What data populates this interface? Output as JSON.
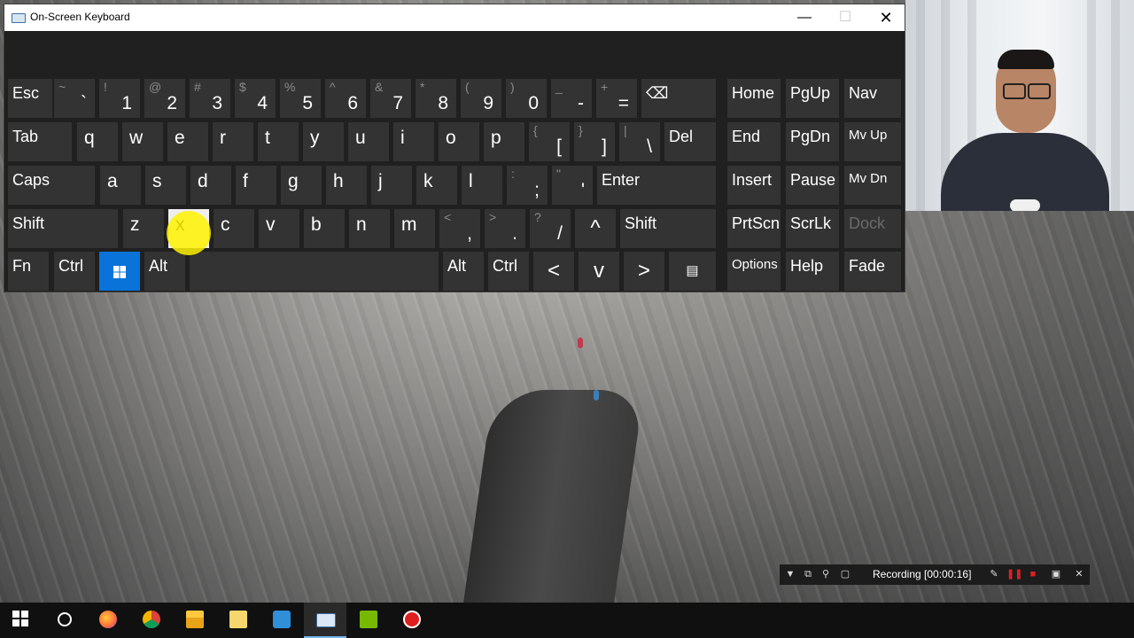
{
  "window": {
    "title": "On-Screen Keyboard"
  },
  "keyboard": {
    "rows": [
      [
        {
          "id": "esc",
          "label": "Esc"
        },
        {
          "id": "backtick",
          "shift": "~",
          "sub": "`"
        },
        {
          "id": "1",
          "shift": "!",
          "sub": "1"
        },
        {
          "id": "2",
          "shift": "@",
          "sub": "2"
        },
        {
          "id": "3",
          "shift": "#",
          "sub": "3"
        },
        {
          "id": "4",
          "shift": "$",
          "sub": "4"
        },
        {
          "id": "5",
          "shift": "%",
          "sub": "5"
        },
        {
          "id": "6",
          "shift": "^",
          "sub": "6"
        },
        {
          "id": "7",
          "shift": "&",
          "sub": "7"
        },
        {
          "id": "8",
          "shift": "*",
          "sub": "8"
        },
        {
          "id": "9",
          "shift": "(",
          "sub": "9"
        },
        {
          "id": "0",
          "shift": ")",
          "sub": "0"
        },
        {
          "id": "minus",
          "shift": "_",
          "sub": "-"
        },
        {
          "id": "equals",
          "shift": "+",
          "sub": "="
        },
        {
          "id": "backspace",
          "label": "⌫"
        }
      ],
      [
        {
          "id": "tab",
          "label": "Tab"
        },
        {
          "id": "q",
          "sub": "q"
        },
        {
          "id": "w",
          "sub": "w"
        },
        {
          "id": "e",
          "sub": "e"
        },
        {
          "id": "r",
          "sub": "r"
        },
        {
          "id": "t",
          "sub": "t"
        },
        {
          "id": "y",
          "sub": "y"
        },
        {
          "id": "u",
          "sub": "u"
        },
        {
          "id": "i",
          "sub": "i"
        },
        {
          "id": "o",
          "sub": "o"
        },
        {
          "id": "p",
          "sub": "p"
        },
        {
          "id": "lbracket",
          "shift": "{",
          "sub": "["
        },
        {
          "id": "rbracket",
          "shift": "}",
          "sub": "]"
        },
        {
          "id": "backslash",
          "shift": "|",
          "sub": "\\"
        },
        {
          "id": "del",
          "label": "Del"
        }
      ],
      [
        {
          "id": "caps",
          "label": "Caps"
        },
        {
          "id": "a",
          "sub": "a"
        },
        {
          "id": "s",
          "sub": "s"
        },
        {
          "id": "d",
          "sub": "d"
        },
        {
          "id": "f",
          "sub": "f"
        },
        {
          "id": "g",
          "sub": "g"
        },
        {
          "id": "h",
          "sub": "h"
        },
        {
          "id": "j",
          "sub": "j"
        },
        {
          "id": "k",
          "sub": "k"
        },
        {
          "id": "l",
          "sub": "l"
        },
        {
          "id": "semicolon",
          "shift": ":",
          "sub": ";"
        },
        {
          "id": "quote",
          "shift": "\"",
          "sub": "'"
        },
        {
          "id": "enter",
          "label": "Enter"
        }
      ],
      [
        {
          "id": "lshift",
          "label": "Shift"
        },
        {
          "id": "z",
          "sub": "z"
        },
        {
          "id": "x",
          "label": "x"
        },
        {
          "id": "c",
          "sub": "c"
        },
        {
          "id": "v",
          "sub": "v"
        },
        {
          "id": "b",
          "sub": "b"
        },
        {
          "id": "n",
          "sub": "n"
        },
        {
          "id": "m",
          "sub": "m"
        },
        {
          "id": "comma",
          "shift": "<",
          "sub": ","
        },
        {
          "id": "period",
          "shift": ">",
          "sub": "."
        },
        {
          "id": "slash",
          "shift": "?",
          "sub": "/"
        },
        {
          "id": "up",
          "label": "^"
        },
        {
          "id": "rshift",
          "label": "Shift"
        }
      ],
      [
        {
          "id": "fn",
          "label": "Fn"
        },
        {
          "id": "lctrl",
          "label": "Ctrl"
        },
        {
          "id": "win",
          "label": ""
        },
        {
          "id": "lalt",
          "label": "Alt"
        },
        {
          "id": "space",
          "label": ""
        },
        {
          "id": "ralt",
          "label": "Alt"
        },
        {
          "id": "rctrl",
          "label": "Ctrl"
        },
        {
          "id": "left",
          "label": "<"
        },
        {
          "id": "down",
          "label": "v"
        },
        {
          "id": "right",
          "label": ">"
        },
        {
          "id": "menu",
          "label": "▤"
        }
      ]
    ],
    "nav_keys": [
      {
        "id": "home",
        "label": "Home"
      },
      {
        "id": "pgup",
        "label": "PgUp"
      },
      {
        "id": "nav",
        "label": "Nav"
      },
      {
        "id": "end",
        "label": "End"
      },
      {
        "id": "pgdn",
        "label": "PgDn"
      },
      {
        "id": "mvup",
        "label": "Mv Up"
      },
      {
        "id": "insert",
        "label": "Insert"
      },
      {
        "id": "pause",
        "label": "Pause"
      },
      {
        "id": "mvdn",
        "label": "Mv Dn"
      },
      {
        "id": "prtscn",
        "label": "PrtScn"
      },
      {
        "id": "scrlk",
        "label": "ScrLk"
      },
      {
        "id": "dock",
        "label": "Dock"
      },
      {
        "id": "options",
        "label": "Options"
      },
      {
        "id": "help",
        "label": "Help"
      },
      {
        "id": "fade",
        "label": "Fade"
      }
    ],
    "pressed_key": "x",
    "colors": {
      "key_bg": "#333333",
      "window_bg": "#202020",
      "highlight": "#fff200",
      "win_key": "#0a73d9"
    }
  },
  "recorder": {
    "status": "Recording [00:00:16]"
  },
  "taskbar": {
    "apps": [
      "start-icon",
      "search-icon",
      "firefox-icon",
      "chrome-icon",
      "file-explorer-icon",
      "folder-icon",
      "network-icon",
      "on-screen-keyboard-icon",
      "nvidia-icon",
      "recorder-icon"
    ],
    "active_app": "on-screen-keyboard-icon"
  }
}
